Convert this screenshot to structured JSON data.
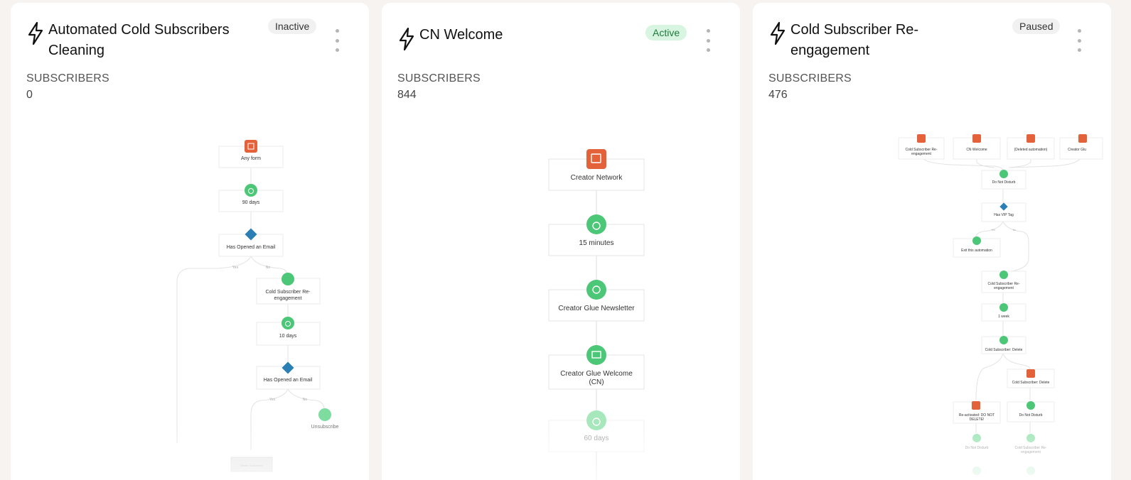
{
  "cards": [
    {
      "title_line1": "Automated Cold Subscribers",
      "title_line2": "Cleaning",
      "status": "Inactive",
      "subscribers_label": "SUBSCRIBERS",
      "subscribers_count": "0",
      "flow": {
        "trigger": "Any form",
        "delay1": "90 days",
        "condition1": "Has Opened an Email",
        "yes_label": "Yes",
        "no_label": "No",
        "action1_line1": "Cold Subscriber Re-",
        "action1_line2": "engagement",
        "delay2": "10 days",
        "condition2": "Has Opened an Email",
        "action2": "Unsubscribe",
        "end_button": "Delete Subscriber"
      }
    },
    {
      "title_line1": "CN Welcome",
      "status": "Active",
      "subscribers_label": "SUBSCRIBERS",
      "subscribers_count": "844",
      "flow": {
        "trigger": "Creator Network",
        "delay1": "15 minutes",
        "step2": "Creator Glue Newsletter",
        "step3_line1": "Creator Glue Welcome",
        "step3_line2": "(CN)",
        "delay2": "60 days"
      }
    },
    {
      "title_line1": "Cold Subscriber Re-",
      "title_line2": "engagement",
      "status": "Paused",
      "subscribers_label": "SUBSCRIBERS",
      "subscribers_count": "476",
      "flow": {
        "trigger1_line1": "Cold Subscriber Re-",
        "trigger1_line2": "engagement",
        "trigger2": "CN Welcome",
        "trigger3": "(Deleted automation)",
        "trigger4": "Creator Glu",
        "step1": "Do Not Disturb",
        "condition1": "Has VIP Tag",
        "yes_label": "Yes",
        "no_label": "No",
        "exit": "Exit this automation",
        "step2_line1": "Cold Subscriber Re-",
        "step2_line2": "engagement",
        "delay1": "1 week",
        "step3": "Cold Subscriber: Delete",
        "step4": "Cold Subscriber: Delete",
        "step5_line1": "Re-activated: DO NOT",
        "step5_line2": "DELETE!",
        "step6": "Do Not Disturb",
        "step7": "Do Not Disturb",
        "step8_line1": "Cold Subscriber Re-",
        "step8_line2": "engagement"
      }
    }
  ],
  "colors": {
    "trigger_orange": "#e4623a",
    "action_green": "#4cc677",
    "condition_blue": "#2a7fb5",
    "active_badge_bg": "#d8f5e1",
    "active_badge_text": "#1f7a3d"
  },
  "icons": {
    "card_icon": "lightning-bolt-icon",
    "menu": "kebab-menu-icon",
    "trigger": "form-icon",
    "delay": "timer-icon",
    "condition": "condition-diamond-icon",
    "email": "email-icon",
    "exit": "exit-icon"
  }
}
